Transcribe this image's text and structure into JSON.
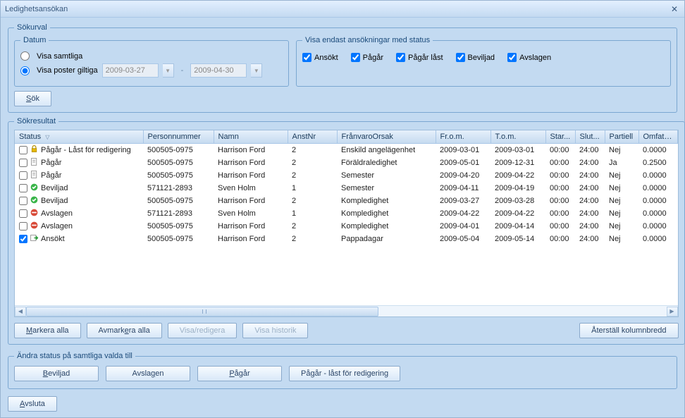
{
  "window": {
    "title": "Ledighetsansökan"
  },
  "sokurval": {
    "legend": "Sökurval",
    "datum": {
      "legend": "Datum",
      "visa_samtliga": "Visa samtliga",
      "visa_poster": "Visa poster giltiga",
      "date_from": "2009-03-27",
      "date_to": "2009-04-30"
    },
    "statusfilter": {
      "legend": "Visa endast ansökningar med status",
      "ansokt": "Ansökt",
      "pagar": "Pågår",
      "pagar_last": "Pågår låst",
      "beviljad": "Beviljad",
      "avslagen": "Avslagen"
    },
    "sok": "Sök"
  },
  "results": {
    "legend": "Sökresultat",
    "columns": {
      "status": "Status",
      "pn": "Personnummer",
      "namn": "Namn",
      "anst": "AnstNr",
      "orsak": "FrånvaroOrsak",
      "from": "Fr.o.m.",
      "tom": "T.o.m.",
      "start": "Star...",
      "slut": "Slut...",
      "part": "Partiell",
      "omf": "Omfatt..."
    },
    "rows": [
      {
        "checked": false,
        "icon": "lock",
        "status": "Pågår - Låst för redigering",
        "pn": "500505-0975",
        "namn": "Harrison Ford",
        "anst": "2",
        "orsak": "Enskild angelägenhet",
        "from": "2009-03-01",
        "tom": "2009-03-01",
        "start": "00:00",
        "slut": "24:00",
        "part": "Nej",
        "omf": "0.0000"
      },
      {
        "checked": false,
        "icon": "doc",
        "status": "Pågår",
        "pn": "500505-0975",
        "namn": "Harrison Ford",
        "anst": "2",
        "orsak": "Föräldraledighet",
        "from": "2009-05-01",
        "tom": "2009-12-31",
        "start": "00:00",
        "slut": "24:00",
        "part": "Ja",
        "omf": "0.2500"
      },
      {
        "checked": false,
        "icon": "doc",
        "status": "Pågår",
        "pn": "500505-0975",
        "namn": "Harrison Ford",
        "anst": "2",
        "orsak": "Semester",
        "from": "2009-04-20",
        "tom": "2009-04-22",
        "start": "00:00",
        "slut": "24:00",
        "part": "Nej",
        "omf": "0.0000"
      },
      {
        "checked": false,
        "icon": "ok",
        "status": "Beviljad",
        "pn": "571121-2893",
        "namn": "Sven Holm",
        "anst": "1",
        "orsak": "Semester",
        "from": "2009-04-11",
        "tom": "2009-04-19",
        "start": "00:00",
        "slut": "24:00",
        "part": "Nej",
        "omf": "0.0000"
      },
      {
        "checked": false,
        "icon": "ok",
        "status": "Beviljad",
        "pn": "500505-0975",
        "namn": "Harrison Ford",
        "anst": "2",
        "orsak": "Kompledighet",
        "from": "2009-03-27",
        "tom": "2009-03-28",
        "start": "00:00",
        "slut": "24:00",
        "part": "Nej",
        "omf": "0.0000"
      },
      {
        "checked": false,
        "icon": "no",
        "status": "Avslagen",
        "pn": "571121-2893",
        "namn": "Sven Holm",
        "anst": "1",
        "orsak": "Kompledighet",
        "from": "2009-04-22",
        "tom": "2009-04-22",
        "start": "00:00",
        "slut": "24:00",
        "part": "Nej",
        "omf": "0.0000"
      },
      {
        "checked": false,
        "icon": "no",
        "status": "Avslagen",
        "pn": "500505-0975",
        "namn": "Harrison Ford",
        "anst": "2",
        "orsak": "Kompledighet",
        "from": "2009-04-01",
        "tom": "2009-04-14",
        "start": "00:00",
        "slut": "24:00",
        "part": "Nej",
        "omf": "0.0000"
      },
      {
        "checked": true,
        "icon": "send",
        "status": "Ansökt",
        "pn": "500505-0975",
        "namn": "Harrison Ford",
        "anst": "2",
        "orsak": "Pappadagar",
        "from": "2009-05-04",
        "tom": "2009-05-14",
        "start": "00:00",
        "slut": "24:00",
        "part": "Nej",
        "omf": "0.0000"
      }
    ],
    "buttons": {
      "markera": "Markera alla",
      "avmarkera": "Avmarkera alla",
      "visa_redigera": "Visa/redigera",
      "visa_historik": "Visa historik",
      "aterstall": "Återställ kolumnbredd"
    }
  },
  "change_status": {
    "legend": "Ändra status på samtliga valda till",
    "beviljad": "Beviljad",
    "avslagen": "Avslagen",
    "pagar": "Pågår",
    "pagar_last": "Pågår - låst för redigering"
  },
  "exit": "Avsluta"
}
